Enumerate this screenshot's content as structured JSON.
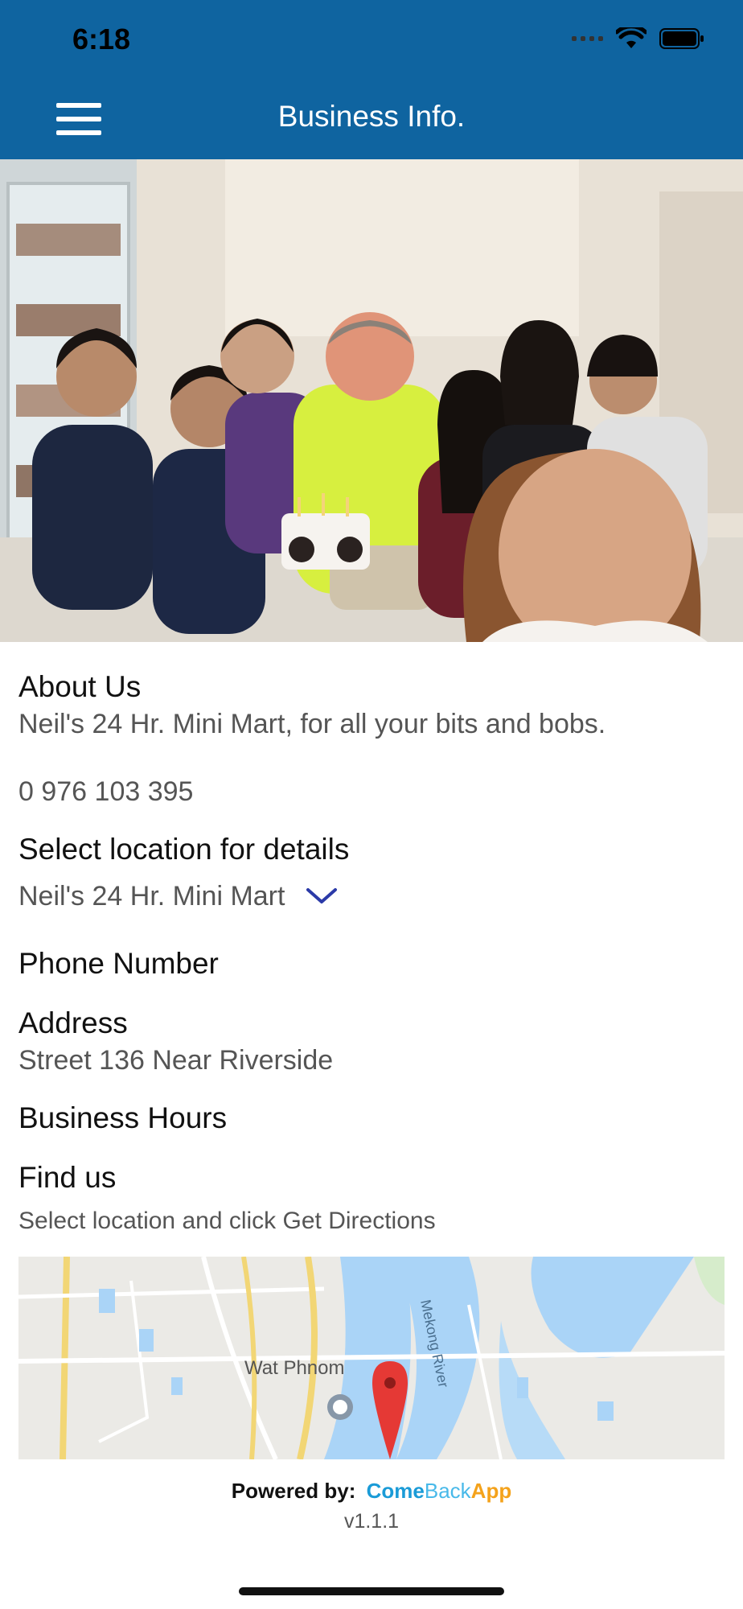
{
  "status_bar": {
    "time": "6:18"
  },
  "header": {
    "title": "Business Info."
  },
  "about": {
    "label": "About Us",
    "text": "Neil's 24 Hr. Mini Mart, for all your bits and bobs.",
    "phone": "0 976 103 395"
  },
  "location": {
    "label": "Select location for details",
    "selected": "Neil's 24 Hr. Mini Mart"
  },
  "phone_section": {
    "label": "Phone Number"
  },
  "address": {
    "label": "Address",
    "value": "Street 136 Near Riverside"
  },
  "hours": {
    "label": "Business Hours"
  },
  "find_us": {
    "label": "Find us",
    "hint": "Select location and click Get Directions"
  },
  "map": {
    "place_label": "Wat Phnom",
    "river_label": "Mekong River"
  },
  "footer": {
    "powered_by": "Powered by:",
    "brand_come": "Come",
    "brand_back": "Back",
    "brand_app": "App",
    "version": "v1.1.1"
  },
  "colors": {
    "header": "#0f64a0",
    "accent": "#2b3aa8",
    "marker": "#e53935"
  }
}
